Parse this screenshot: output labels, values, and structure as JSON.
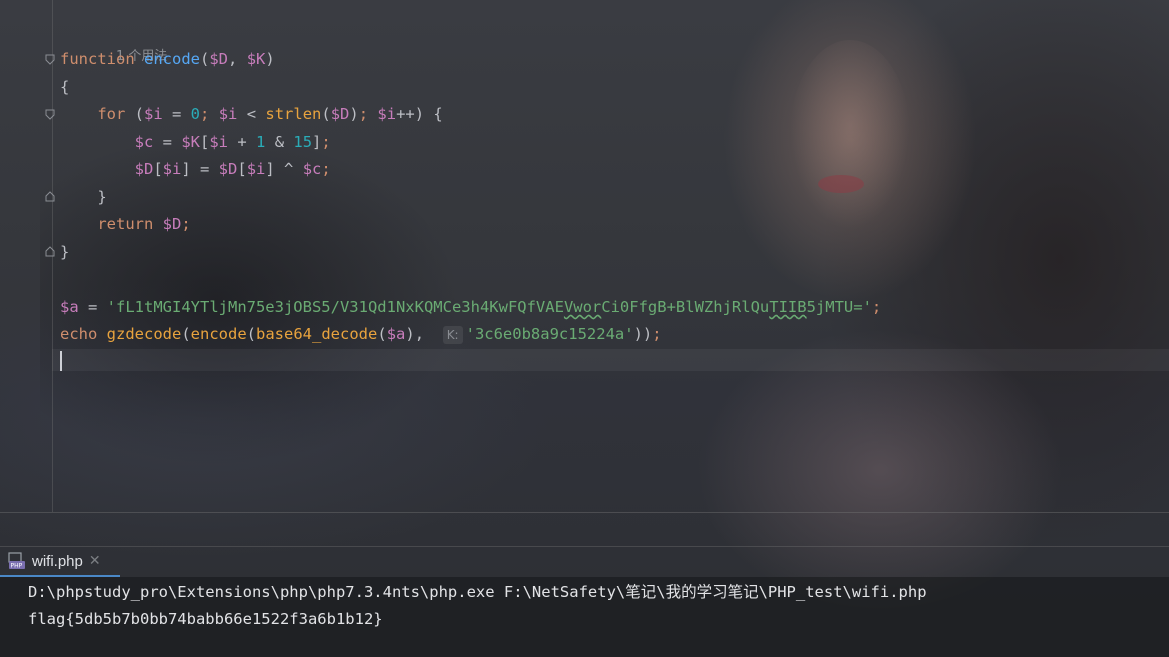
{
  "editor": {
    "usages_hint": "1 个用法",
    "code_lines": [
      "function encode($D, $K)",
      "{",
      "    for ($i = 0; $i < strlen($D); $i++) {",
      "        $c = $K[$i + 1 & 15];",
      "        $D[$i] = $D[$i] ^ $c;",
      "    }",
      "    return $D;",
      "}",
      "",
      "$a = 'fL1tMGI4YTljMn75e3jOBS5/V31Qd1NxKQMCe3h4KwFQfVAEVworCi0FfgB+BlWZhjRlQuTIIB5jMTU=';",
      "echo gzdecode(encode(base64_decode($a), K: '3c6e0b8a9c15224a'));"
    ],
    "param_hint": "K:"
  },
  "run_panel": {
    "tab_label": "wifi.php",
    "tab_icon": "php-file-icon",
    "console_lines": [
      "D:\\phpstudy_pro\\Extensions\\php\\php7.3.4nts\\php.exe F:\\NetSafety\\笔记\\我的学习笔记\\PHP_test\\wifi.php",
      "flag{5db5b7b0bb74babb66e1522f3a6b1b12}"
    ]
  },
  "colors": {
    "keyword": "#cf8e6d",
    "function_decl": "#56a8f5",
    "function_call": "#e8a33e",
    "variable": "#c77dbb",
    "number": "#2aacb8",
    "string": "#6aab73"
  }
}
